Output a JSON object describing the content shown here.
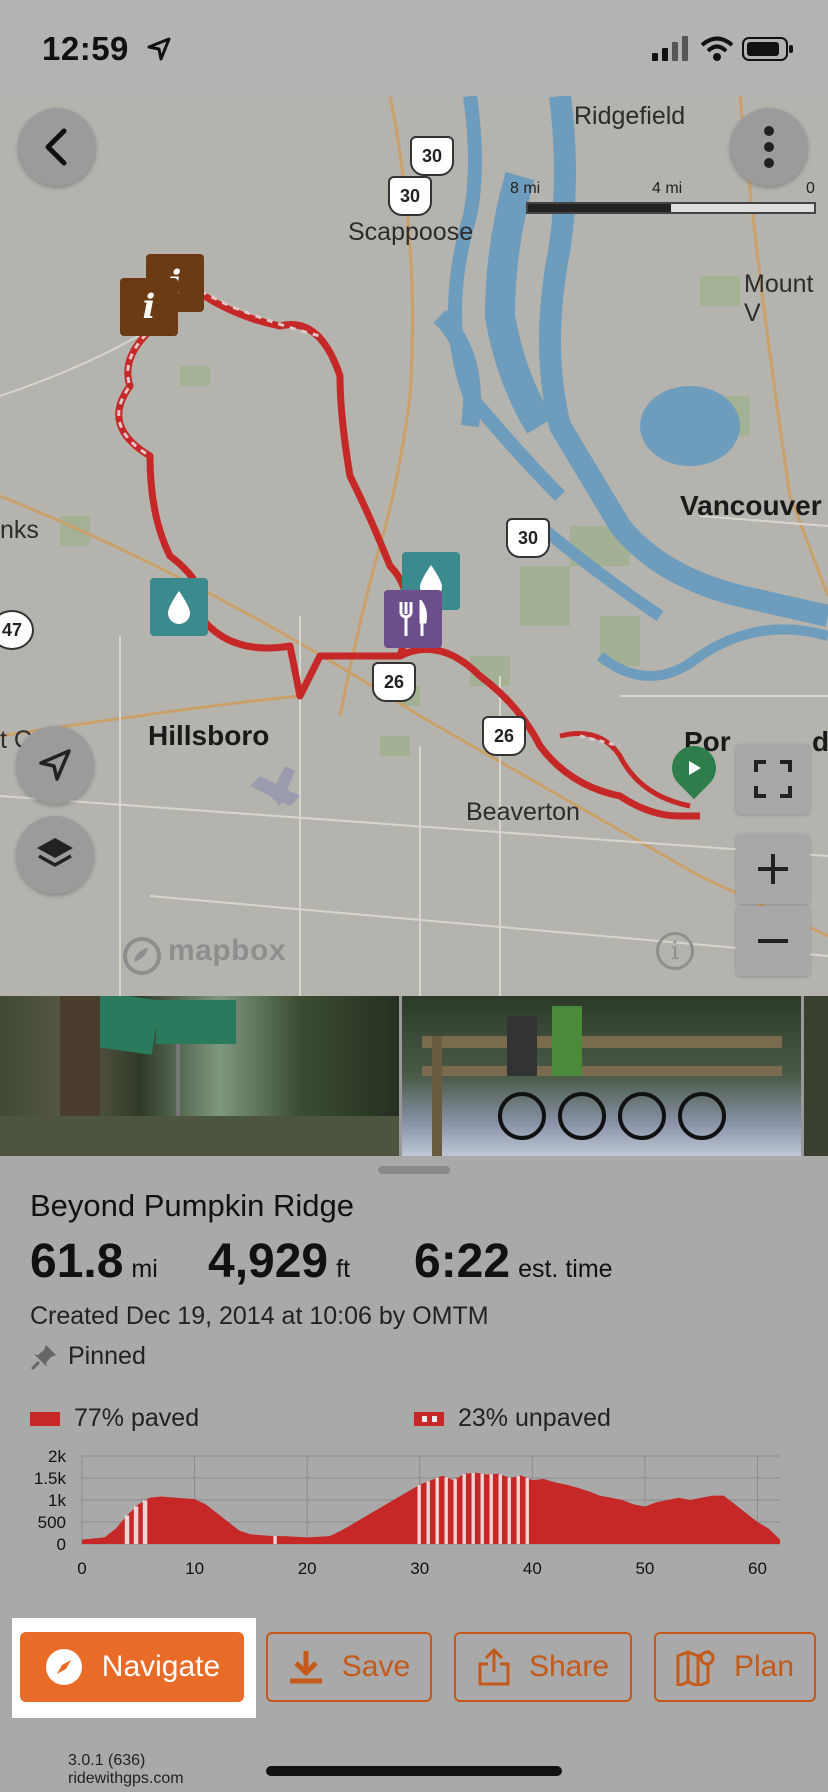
{
  "status": {
    "time": "12:59"
  },
  "map": {
    "scale": {
      "left": "8 mi",
      "mid": "4 mi",
      "right": "0"
    },
    "labels": {
      "ridgefield": "Ridgefield",
      "scappoose": "Scappoose",
      "mount": "Mount V",
      "vancouver": "Vancouver",
      "banks": "nks",
      "hillsboro": "Hillsboro",
      "beaverton": "Beaverton",
      "portland_a": "Por",
      "portland_b": "d",
      "edge": "t C"
    },
    "shields": {
      "s30a": "30",
      "s30b": "30",
      "s30c": "30",
      "s26a": "26",
      "s26b": "26",
      "s47": "47"
    },
    "attribution": "mapbox"
  },
  "route": {
    "name": "Beyond Pumpkin Ridge",
    "distance": {
      "value": "61.8",
      "unit": "mi"
    },
    "elevation": {
      "value": "4,929",
      "unit": "ft"
    },
    "time": {
      "value": "6:22",
      "unit": "est. time"
    },
    "created": "Created Dec 19, 2014 at 10:06 by OMTM",
    "pinned": "Pinned",
    "paved": "77% paved",
    "unpaved": "23% unpaved"
  },
  "chart_data": {
    "type": "area",
    "title": "",
    "xlabel": "",
    "ylabel": "",
    "xlim": [
      0,
      62
    ],
    "ylim": [
      0,
      2000
    ],
    "x_ticks": [
      "0",
      "10",
      "20",
      "30",
      "40",
      "50",
      "60"
    ],
    "y_ticks": [
      "0",
      "500",
      "1k",
      "1.5k",
      "2k"
    ],
    "grid": true,
    "series": [
      {
        "name": "",
        "x": [
          0,
          2,
          3,
          4,
          5,
          6,
          7,
          8,
          9,
          10,
          11,
          12,
          13,
          14,
          15,
          16,
          17,
          18,
          20,
          22,
          23,
          24,
          25,
          26,
          27,
          28,
          29,
          30,
          31,
          32,
          33,
          34,
          35,
          36,
          37,
          38,
          39,
          40,
          41,
          42,
          43,
          44,
          45,
          46,
          47,
          48,
          49,
          50,
          51,
          52,
          53,
          54,
          55,
          56,
          57,
          58,
          59,
          60,
          61,
          62
        ],
        "y": [
          100,
          150,
          350,
          650,
          900,
          1050,
          1080,
          1060,
          1040,
          1020,
          900,
          700,
          500,
          300,
          220,
          200,
          180,
          180,
          150,
          180,
          300,
          450,
          600,
          750,
          900,
          1050,
          1200,
          1350,
          1450,
          1550,
          1450,
          1600,
          1620,
          1580,
          1600,
          1500,
          1560,
          1450,
          1480,
          1400,
          1350,
          1280,
          1200,
          1100,
          1050,
          1000,
          900,
          850,
          950,
          1000,
          1050,
          1000,
          1050,
          1100,
          1100,
          900,
          700,
          500,
          350,
          100
        ]
      }
    ],
    "unpaved_bands": [
      [
        3.8,
        4.2
      ],
      [
        4.6,
        5.0
      ],
      [
        5.4,
        5.8
      ],
      [
        17.0,
        17.3
      ],
      [
        29.8,
        30.1
      ],
      [
        30.6,
        30.9
      ],
      [
        31.4,
        31.7
      ],
      [
        32.2,
        32.5
      ],
      [
        33.0,
        33.3
      ],
      [
        33.8,
        34.1
      ],
      [
        34.6,
        34.9
      ],
      [
        35.4,
        35.7
      ],
      [
        36.2,
        36.5
      ],
      [
        37.0,
        37.3
      ],
      [
        37.8,
        38.1
      ],
      [
        38.6,
        38.9
      ],
      [
        39.4,
        39.7
      ]
    ]
  },
  "actions": {
    "navigate": "Navigate",
    "save": "Save",
    "share": "Share",
    "plan": "Plan"
  },
  "footer": {
    "version": "3.0.1 (636)",
    "site": "ridewithgps.com"
  },
  "colors": {
    "accent": "#e86c28",
    "route": "#c62828",
    "primary_text": "#111111"
  }
}
